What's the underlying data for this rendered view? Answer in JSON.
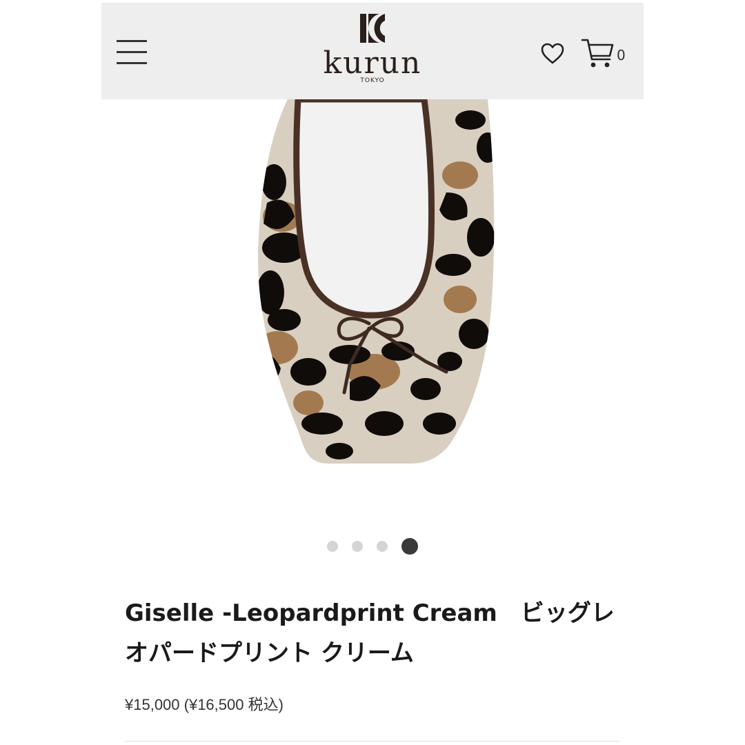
{
  "header": {
    "menu_icon": "hamburger-menu-icon",
    "logo_word": "kurun",
    "logo_sub": "TOKYO",
    "wishlist_icon": "heart-icon",
    "cart_icon": "cart-icon",
    "cart_count": "0"
  },
  "gallery": {
    "image_subject": "leopard print ballet flat",
    "slide_count": 4,
    "active_slide": 4
  },
  "product": {
    "title": "Giselle -Leopardprint Cream　ビッグレオパードプリント クリーム",
    "price": "¥15,000 (¥16,500 税込)"
  },
  "colors": {
    "header_bg": "#eeeeee",
    "dot_active": "#3a3a3a",
    "dot_inactive": "#d4d4d4",
    "brand": "#2a1f1b"
  }
}
